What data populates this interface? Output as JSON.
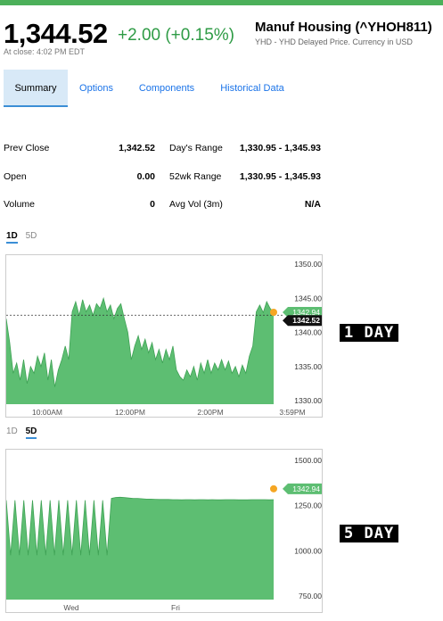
{
  "quote": {
    "price": "1,344.52",
    "change": "+2.00 (+0.15%)",
    "close_time": "At close: 4:02 PM EDT",
    "name": "Manuf Housing (^YHOH811)",
    "subtitle": "YHD - YHD Delayed Price. Currency in USD"
  },
  "tabs": [
    {
      "label": "Summary",
      "active": true
    },
    {
      "label": "Options",
      "active": false
    },
    {
      "label": "Components",
      "active": false
    },
    {
      "label": "Historical Data",
      "active": false
    }
  ],
  "stats": [
    {
      "label": "Prev Close",
      "value": "1,342.52",
      "label2": "Day's Range",
      "value2": "1,330.95 - 1,345.93"
    },
    {
      "label": "Open",
      "value": "0.00",
      "label2": "52wk Range",
      "value2": "1,330.95 - 1,345.93"
    },
    {
      "label": "Volume",
      "value": "0",
      "label2": "Avg Vol (3m)",
      "value2": "N/A"
    }
  ],
  "chart1": {
    "range_tabs": [
      {
        "label": "1D",
        "active": true
      },
      {
        "label": "5D",
        "active": false
      }
    ],
    "badge_current": "1342.94",
    "badge_prev": "1342.52",
    "side_label": "1 DAY"
  },
  "chart2": {
    "range_tabs": [
      {
        "label": "1D",
        "active": false
      },
      {
        "label": "5D",
        "active": true
      }
    ],
    "badge_current": "1342.94",
    "side_label": "5 DAY"
  },
  "colors": {
    "accent_green": "#4cb05a",
    "fill_green": "#5dbe72",
    "link_blue": "#1a73e8",
    "dot_orange": "#f5a623"
  },
  "chart_data": [
    {
      "type": "area",
      "x_labels": [
        "10:00AM",
        "12:00PM",
        "2:00PM",
        "3:59PM"
      ],
      "y_ticks": [
        "1350.00",
        "1345.00",
        "1340.00",
        "1335.00",
        "1330.00"
      ],
      "ylim": [
        1330,
        1350
      ],
      "prev_close": 1342.52,
      "last": 1342.94,
      "values": [
        1342.0,
        1338.5,
        1334.0,
        1335.5,
        1333.0,
        1336.0,
        1332.5,
        1335.0,
        1334.0,
        1336.5,
        1335.0,
        1337.0,
        1333.0,
        1336.0,
        1332.0,
        1334.5,
        1336.0,
        1338.0,
        1336.0,
        1343.0,
        1344.5,
        1342.5,
        1344.8,
        1343.0,
        1344.0,
        1342.5,
        1344.2,
        1343.5,
        1345.0,
        1343.0,
        1344.0,
        1342.0,
        1343.5,
        1344.2,
        1342.0,
        1340.0,
        1336.0,
        1338.0,
        1339.5,
        1337.5,
        1339.0,
        1337.0,
        1338.5,
        1336.0,
        1337.5,
        1335.5,
        1337.5,
        1336.0,
        1338.0,
        1334.5,
        1333.5,
        1333.0,
        1334.5,
        1333.5,
        1335.0,
        1333.0,
        1335.5,
        1334.0,
        1336.0,
        1334.0,
        1335.5,
        1334.5,
        1336.0,
        1334.5,
        1335.8,
        1334.0,
        1335.0,
        1333.5,
        1335.2,
        1334.0,
        1336.5,
        1338.0,
        1343.0,
        1344.0,
        1342.9,
        1344.5,
        1343.5,
        1342.94
      ],
      "grid": false
    },
    {
      "type": "area",
      "x_labels": [
        "Wed",
        "Fri"
      ],
      "y_ticks": [
        "1500.00",
        "1250.00",
        "1000.00",
        "750.00"
      ],
      "ylim": [
        750,
        1500
      ],
      "last": 1342.94,
      "values": [
        1280,
        975,
        1280,
        975,
        1280,
        975,
        1280,
        975,
        1280,
        975,
        1280,
        975,
        1280,
        975,
        1280,
        975,
        1280,
        975,
        1280,
        975,
        1280,
        975,
        1280,
        975,
        1290,
        1295,
        1296,
        1294,
        1292,
        1290,
        1290,
        1288,
        1286,
        1286,
        1285,
        1284,
        1284,
        1284,
        1283,
        1283,
        1282,
        1283,
        1283,
        1282,
        1283,
        1283,
        1282,
        1283,
        1282,
        1282,
        1283,
        1283,
        1283,
        1282,
        1282,
        1282,
        1283,
        1283,
        1283,
        1283,
        1282,
        1283
      ],
      "grid": false
    }
  ]
}
